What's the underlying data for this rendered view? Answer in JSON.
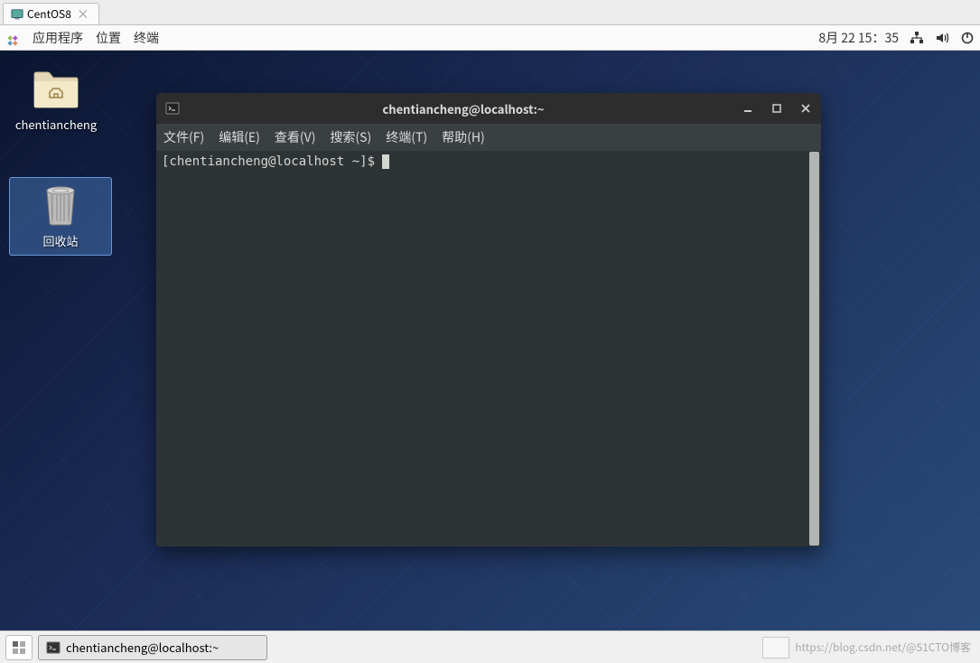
{
  "vm_tab": {
    "label": "CentOS8"
  },
  "panel": {
    "applications": "应用程序",
    "places": "位置",
    "terminal": "终端",
    "datetime": "8月 22 15：35"
  },
  "desktop_icons": {
    "home_folder": "chentiancheng",
    "trash": "回收站"
  },
  "terminal": {
    "title": "chentiancheng@localhost:~",
    "menu": {
      "file": "文件(F)",
      "edit": "编辑(E)",
      "view": "查看(V)",
      "search": "搜索(S)",
      "terminal": "终端(T)",
      "help": "帮助(H)"
    },
    "prompt": "[chentiancheng@localhost ~]$ "
  },
  "taskbar": {
    "window_title": "chentiancheng@localhost:~"
  },
  "watermark": "https://blog.csdn.net/@51CTO博客"
}
